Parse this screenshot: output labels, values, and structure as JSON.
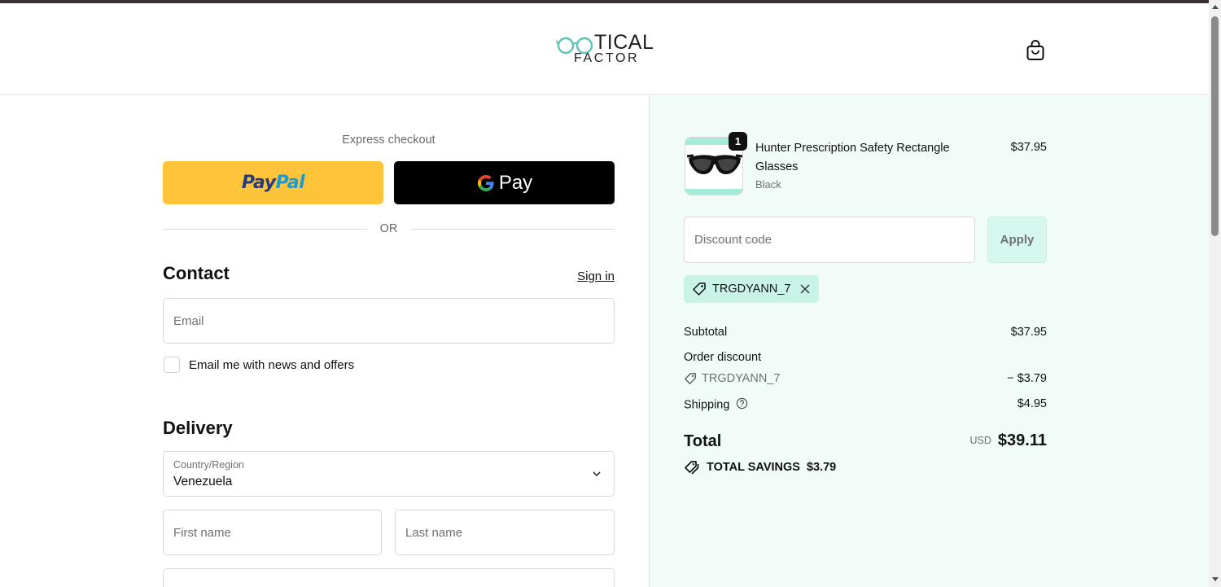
{
  "header": {
    "logo_top": "TICAL",
    "logo_bottom": "FACTOR",
    "logo_full": "OPTICAL FACTOR"
  },
  "express": {
    "label": "Express checkout",
    "paypal_part1": "Pay",
    "paypal_part2": "Pal",
    "gpay_label": "Pay",
    "or_label": "OR"
  },
  "contact": {
    "title": "Contact",
    "signin_label": "Sign in",
    "email_placeholder": "Email",
    "newsletter_label": "Email me with news and offers"
  },
  "delivery": {
    "title": "Delivery",
    "country_label": "Country/Region",
    "country_value": "Venezuela",
    "first_name_placeholder": "First name",
    "last_name_placeholder": "Last name"
  },
  "cart": {
    "items": [
      {
        "quantity": "1",
        "name": "Hunter Prescription Safety Rectangle Glasses",
        "variant": "Black",
        "price": "$37.95"
      }
    ]
  },
  "discount": {
    "placeholder": "Discount code",
    "apply_label": "Apply",
    "applied_code": "TRGDYANN_7"
  },
  "summary": {
    "subtotal_label": "Subtotal",
    "subtotal_value": "$37.95",
    "order_discount_label": "Order discount",
    "discount_code": "TRGDYANN_7",
    "discount_value": "− $3.79",
    "shipping_label": "Shipping",
    "shipping_value": "$4.95",
    "total_label": "Total",
    "total_currency": "USD",
    "total_value": "$39.11",
    "savings_label": "TOTAL SAVINGS",
    "savings_value": "$3.79"
  },
  "colors": {
    "accent_teal": "#5fc3b6",
    "summary_bg": "#f1fcf9",
    "chip_bg": "#c9f3e7",
    "paypal_yellow": "#ffc439"
  },
  "icons": {
    "cart": "shopping-bag-icon",
    "tag": "tag-icon",
    "close": "close-icon",
    "help": "question-circle-icon",
    "chevron": "chevron-down-icon",
    "savings": "double-tag-icon"
  }
}
